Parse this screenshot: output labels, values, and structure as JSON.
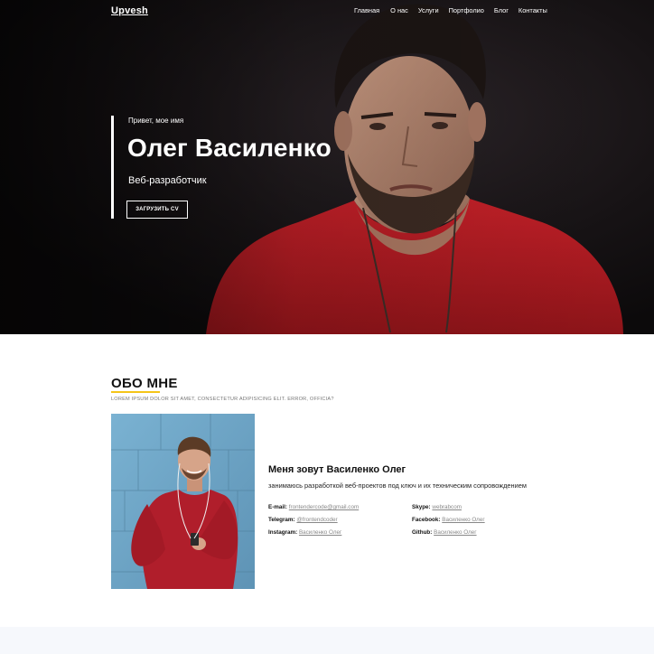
{
  "colors": {
    "accent": "#f5c518",
    "hero_bg": "#141113",
    "shirt": "#b31b22",
    "wall": "#6fa7c8"
  },
  "nav": {
    "logo": "Upvesh",
    "items": [
      "Главная",
      "О нас",
      "Услуги",
      "Портфолио",
      "Блог",
      "Контакты"
    ]
  },
  "hero": {
    "hello": "Привет, мое имя",
    "name": "Олег Василенко",
    "role": "Веб-разработчик",
    "cv_button": "ЗАГРУЗИТЬ CV"
  },
  "about": {
    "title": "ОБО МНЕ",
    "subtitle": "LOREM IPSUM DOLOR SIT AMET, CONSECTETUR ADIPISICING ELIT. ERROR, OFFICIA?",
    "greeting": "Меня зовут Василенко Олег",
    "description": "занимаюсь разработкой веб-проектов под ключ и их техническим сопровождением",
    "contacts": [
      {
        "key": "E-mail:",
        "value": "frontendercode@gmail.com"
      },
      {
        "key": "Skype:",
        "value": "webrabcom"
      },
      {
        "key": "Telegram:",
        "value": "@frontendcoder"
      },
      {
        "key": "Facebook:",
        "value": "Василенко Олег"
      },
      {
        "key": "Instagram:",
        "value": "Василенко Олег"
      },
      {
        "key": "Github:",
        "value": "Василенко Олег"
      }
    ]
  }
}
